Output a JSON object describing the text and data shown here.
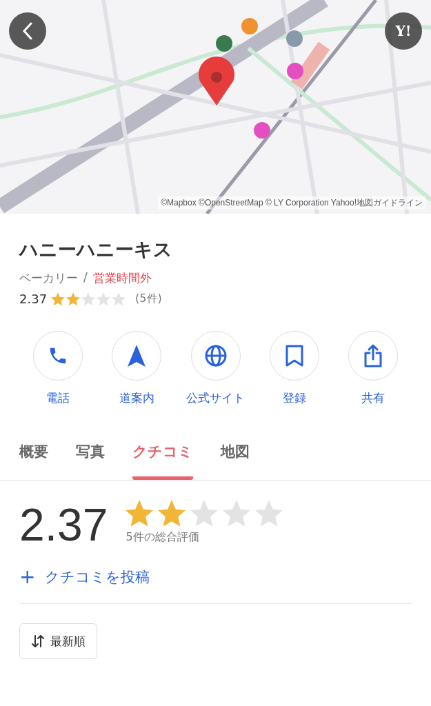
{
  "map": {
    "attribution": "©Mapbox ©OpenStreetMap © LY Corporation Yahoo!地図ガイドライン",
    "logo": "Y!"
  },
  "place": {
    "name": "ハニーハニーキス",
    "category": "ベーカリー",
    "separator": "/",
    "status": "営業時間外",
    "rating": "2.37",
    "stars": 2,
    "count": "(5件)"
  },
  "actions": [
    {
      "kind": "phone",
      "label": "電話"
    },
    {
      "kind": "directions",
      "label": "道案内"
    },
    {
      "kind": "web",
      "label": "公式サイト"
    },
    {
      "kind": "save",
      "label": "登録"
    },
    {
      "kind": "share",
      "label": "共有"
    }
  ],
  "tabs": [
    {
      "label": "概要",
      "selected": false
    },
    {
      "label": "写真",
      "selected": false
    },
    {
      "label": "クチコミ",
      "selected": true
    },
    {
      "label": "地図",
      "selected": false
    }
  ],
  "summary": {
    "rating": "2.37",
    "stars": 2,
    "caption": "5件の総合評価",
    "post": "クチコミを投稿",
    "post_icon": "+"
  },
  "sort": {
    "label": "最新順"
  }
}
